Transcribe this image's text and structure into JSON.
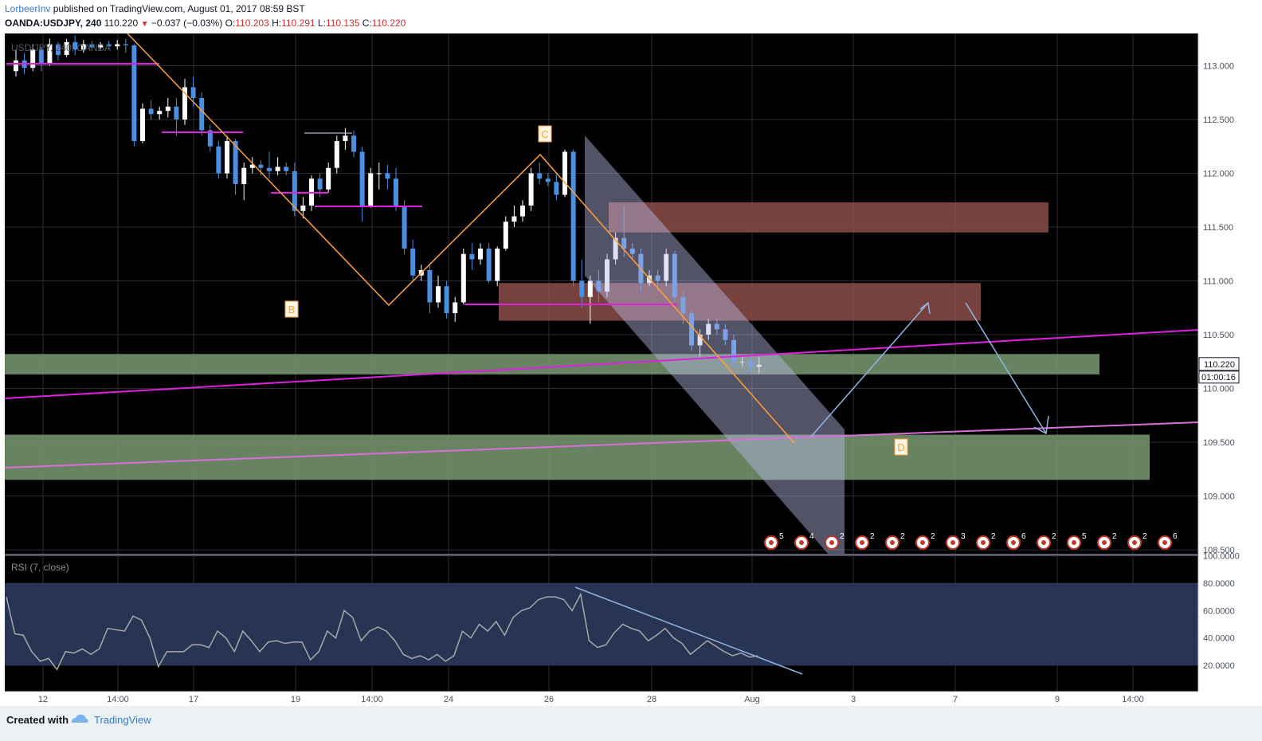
{
  "header": {
    "author": "LorbeerInv",
    "published": "published on TradingView.com, August 01, 2017 08:59 BST",
    "symbol_line": "OANDA:USDJPY, 240",
    "last": "110.220",
    "change": "−0.037 (−0.03%)",
    "o_label": "O:",
    "o": "110.203",
    "h_label": "H:",
    "h": "110.291",
    "l_label": "L:",
    "l": "110.135",
    "c_label": "C:",
    "c": "110.220"
  },
  "watermark": "USD/JPY, 240, OANDA",
  "footer": {
    "created": "Created with",
    "brand": "TradingView"
  },
  "colors": {
    "background": "#000000",
    "bull": "#ffffff",
    "bear": "#4a90e2",
    "fib_line": "#ff9f3a",
    "support_line": "#e020e0",
    "zone_green": "#7a9a72",
    "zone_red": "#8c4e48",
    "channel": "#b8b9e6",
    "rsi_band": "#2b3a5c",
    "rsi_line": "#a8a8a8",
    "projection": "#8fb6e6"
  },
  "chart_data": {
    "type": "candlestick",
    "symbol": "OANDA:USDJPY",
    "timeframe": "240",
    "ylim": [
      108.3,
      113.3
    ],
    "price_ticks": [
      "113.000",
      "112.500",
      "112.000",
      "111.500",
      "111.000",
      "110.500",
      "110.000",
      "109.500",
      "109.000",
      "108.500"
    ],
    "last_price_label": "110.220",
    "countdown_label": "01:00:16",
    "x_ticks": [
      "12",
      "14:00",
      "17",
      "19",
      "14:00",
      "24",
      "26",
      "28",
      "Aug",
      "3",
      "7",
      "9",
      "14:00"
    ],
    "candles": [
      [
        112.95,
        113.05,
        112.9,
        113.15
      ],
      [
        113.05,
        112.98,
        112.92,
        113.12
      ],
      [
        112.98,
        113.15,
        112.95,
        113.2
      ],
      [
        113.15,
        113.02,
        112.95,
        113.18
      ],
      [
        113.02,
        113.2,
        113.0,
        113.25
      ],
      [
        113.2,
        113.1,
        113.05,
        113.22
      ],
      [
        113.1,
        113.22,
        113.08,
        113.25
      ],
      [
        113.22,
        113.15,
        113.1,
        113.28
      ],
      [
        113.15,
        113.2,
        113.12,
        113.24
      ],
      [
        113.2,
        113.17,
        113.14,
        113.23
      ],
      [
        113.17,
        113.2,
        113.15,
        113.22
      ],
      [
        113.2,
        113.18,
        113.15,
        113.23
      ],
      [
        113.18,
        113.2,
        113.15,
        113.24
      ],
      [
        113.2,
        113.19,
        113.12,
        113.25
      ],
      [
        113.19,
        112.3,
        112.25,
        113.2
      ],
      [
        112.3,
        112.6,
        112.28,
        112.65
      ],
      [
        112.6,
        112.55,
        112.5,
        112.68
      ],
      [
        112.55,
        112.58,
        112.5,
        112.62
      ],
      [
        112.58,
        112.62,
        112.52,
        112.7
      ],
      [
        112.62,
        112.5,
        112.35,
        112.7
      ],
      [
        112.5,
        112.8,
        112.45,
        112.88
      ],
      [
        112.8,
        112.7,
        112.62,
        112.9
      ],
      [
        112.7,
        112.4,
        112.35,
        112.75
      ],
      [
        112.4,
        112.25,
        112.2,
        112.45
      ],
      [
        112.25,
        112.0,
        111.95,
        112.3
      ],
      [
        112.0,
        112.3,
        111.95,
        112.35
      ],
      [
        112.3,
        111.9,
        111.8,
        112.32
      ],
      [
        111.9,
        112.05,
        111.75,
        112.1
      ],
      [
        112.05,
        112.08,
        112.0,
        112.15
      ],
      [
        112.08,
        112.05,
        111.98,
        112.12
      ],
      [
        112.05,
        112.02,
        111.95,
        112.2
      ],
      [
        112.02,
        112.06,
        111.98,
        112.15
      ],
      [
        112.06,
        112.02,
        111.98,
        112.1
      ],
      [
        112.02,
        111.65,
        111.6,
        112.1
      ],
      [
        111.65,
        111.7,
        111.58,
        111.78
      ],
      [
        111.7,
        111.95,
        111.65,
        111.98
      ],
      [
        111.95,
        111.85,
        111.78,
        112.0
      ],
      [
        111.85,
        112.05,
        111.82,
        112.1
      ],
      [
        112.05,
        112.3,
        112.0,
        112.35
      ],
      [
        112.3,
        112.35,
        112.22,
        112.42
      ],
      [
        112.35,
        112.2,
        112.15,
        112.4
      ],
      [
        112.2,
        111.7,
        111.55,
        112.25
      ],
      [
        111.7,
        112.0,
        111.68,
        112.05
      ],
      [
        112.0,
        112.0,
        111.85,
        112.1
      ],
      [
        112.0,
        111.95,
        111.85,
        112.08
      ],
      [
        111.95,
        111.7,
        111.65,
        112.05
      ],
      [
        111.7,
        111.3,
        111.25,
        111.75
      ],
      [
        111.3,
        111.05,
        111.0,
        111.38
      ],
      [
        111.05,
        111.1,
        111.0,
        111.15
      ],
      [
        111.1,
        110.8,
        110.7,
        111.15
      ],
      [
        110.8,
        110.95,
        110.75,
        111.05
      ],
      [
        110.95,
        110.7,
        110.65,
        111.0
      ],
      [
        110.7,
        110.8,
        110.62,
        110.85
      ],
      [
        110.8,
        111.25,
        110.78,
        111.3
      ],
      [
        111.25,
        111.2,
        111.1,
        111.35
      ],
      [
        111.2,
        111.3,
        111.15,
        111.35
      ],
      [
        111.3,
        111.0,
        110.98,
        111.35
      ],
      [
        111.0,
        111.3,
        110.95,
        111.32
      ],
      [
        111.3,
        111.55,
        111.28,
        111.6
      ],
      [
        111.55,
        111.6,
        111.5,
        111.7
      ],
      [
        111.6,
        111.7,
        111.55,
        111.75
      ],
      [
        111.7,
        112.0,
        111.65,
        112.05
      ],
      [
        112.0,
        111.95,
        111.9,
        112.1
      ],
      [
        111.95,
        111.92,
        111.88,
        112.0
      ],
      [
        111.92,
        111.8,
        111.75,
        112.0
      ],
      [
        111.8,
        112.2,
        111.78,
        112.22
      ],
      [
        112.2,
        111.0,
        110.95,
        112.22
      ],
      [
        111.0,
        110.85,
        110.75,
        111.2
      ],
      [
        110.85,
        111.0,
        110.6,
        111.05
      ],
      [
        111.0,
        110.9,
        110.8,
        111.1
      ],
      [
        110.9,
        111.2,
        110.85,
        111.25
      ],
      [
        111.2,
        111.4,
        111.15,
        111.45
      ],
      [
        111.4,
        111.3,
        111.22,
        111.7
      ],
      [
        111.3,
        111.25,
        111.2,
        111.35
      ],
      [
        111.25,
        110.98,
        110.9,
        111.3
      ],
      [
        110.98,
        111.05,
        110.95,
        111.1
      ],
      [
        111.05,
        111.0,
        110.9,
        111.1
      ],
      [
        111.0,
        111.25,
        110.95,
        111.3
      ],
      [
        111.25,
        110.85,
        110.8,
        111.28
      ],
      [
        110.85,
        110.7,
        110.6,
        110.9
      ],
      [
        110.7,
        110.4,
        110.35,
        110.72
      ],
      [
        110.4,
        110.5,
        110.3,
        110.55
      ],
      [
        110.5,
        110.6,
        110.45,
        110.65
      ],
      [
        110.6,
        110.55,
        110.5,
        110.65
      ],
      [
        110.55,
        110.45,
        110.4,
        110.6
      ],
      [
        110.45,
        110.25,
        110.2,
        110.5
      ],
      [
        110.25,
        110.25,
        110.2,
        110.3
      ],
      [
        110.25,
        110.2,
        110.15,
        110.3
      ],
      [
        110.2,
        110.22,
        110.14,
        110.29
      ]
    ],
    "zones": [
      {
        "label": "resistance",
        "from": 111.45,
        "to": 111.73
      },
      {
        "label": "resistance",
        "from": 110.63,
        "to": 110.98
      },
      {
        "label": "support",
        "from": 110.13,
        "to": 110.32
      },
      {
        "label": "support",
        "from": 109.15,
        "to": 109.57
      }
    ],
    "pattern_labels": [
      "B",
      "C",
      "D"
    ],
    "rsi": {
      "title": "RSI (7, close)",
      "ticks": [
        "100.0000",
        "80.0000",
        "60.0000",
        "40.0000",
        "20.0000"
      ],
      "ylim": [
        0,
        100
      ],
      "bands": [
        20,
        80
      ],
      "values": [
        70,
        43,
        42,
        30,
        23,
        25,
        17,
        30,
        29,
        32,
        28,
        32,
        47,
        46,
        45,
        56,
        53,
        40,
        19,
        30,
        30,
        30,
        35,
        35,
        33,
        45,
        40,
        30,
        45,
        38,
        30,
        37,
        38,
        36,
        37,
        37,
        24,
        30,
        45,
        40,
        60,
        55,
        38,
        45,
        48,
        45,
        38,
        28,
        25,
        27,
        24,
        28,
        23,
        27,
        45,
        40,
        50,
        45,
        52,
        42,
        55,
        60,
        62,
        68,
        70,
        70,
        68,
        60,
        72,
        38,
        33,
        35,
        44,
        50,
        47,
        45,
        38,
        42,
        47,
        40,
        36,
        28,
        33,
        38,
        34,
        30,
        27,
        29,
        26,
        27
      ]
    },
    "calendar_events": [
      "5",
      "4",
      "2",
      "2",
      "2",
      "2",
      "3",
      "2",
      "6",
      "2",
      "5",
      "2",
      "2",
      "6"
    ]
  }
}
